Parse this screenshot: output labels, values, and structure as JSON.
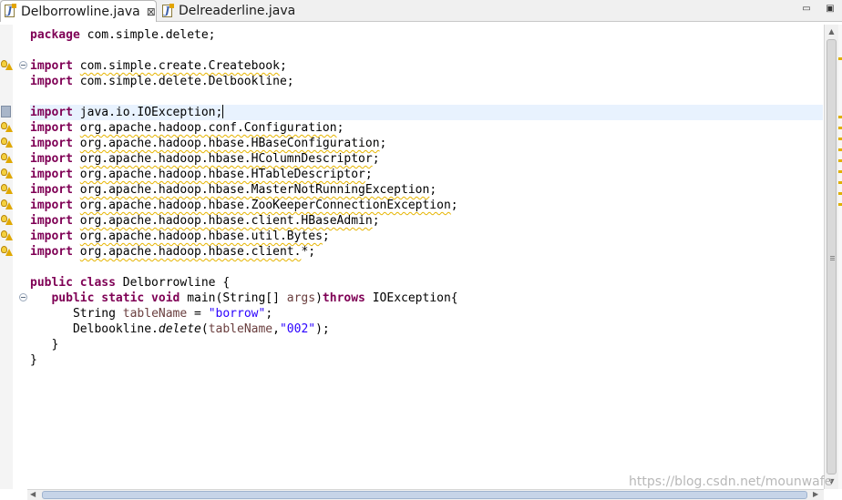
{
  "tabs": [
    {
      "label": "Delborrowline.java",
      "close": "⊠",
      "active": true
    },
    {
      "label": "Delreaderline.java",
      "active": false
    }
  ],
  "window_controls": {
    "minimize": "▭",
    "maximize": "▣"
  },
  "code": {
    "l1": {
      "kw": "package",
      "rest": " com.simple.delete;"
    },
    "l3": {
      "kw": "import",
      "sp": " ",
      "path": "com.simple.create.Createbook",
      "semi": ";"
    },
    "l4": {
      "kw": "import",
      "rest": " com.simple.delete.Delbookline;"
    },
    "l6": {
      "kw": "import",
      "rest": " java.io.IOException;"
    },
    "l7": {
      "kw": "import",
      "sp": " ",
      "path": "org.apache.hadoop.conf.Configuration",
      "semi": ";"
    },
    "l8": {
      "kw": "import",
      "sp": " ",
      "path": "org.apache.hadoop.hbase.HBaseConfiguration",
      "semi": ";"
    },
    "l9": {
      "kw": "import",
      "sp": " ",
      "path": "org.apache.hadoop.hbase.HColumnDescriptor",
      "semi": ";"
    },
    "l10": {
      "kw": "import",
      "sp": " ",
      "path": "org.apache.hadoop.hbase.HTableDescriptor",
      "semi": ";"
    },
    "l11": {
      "kw": "import",
      "sp": " ",
      "path": "org.apache.hadoop.hbase.MasterNotRunningException",
      "semi": ";"
    },
    "l12": {
      "kw": "import",
      "sp": " ",
      "path": "org.apache.hadoop.hbase.ZooKeeperConnectionException",
      "semi": ";"
    },
    "l13": {
      "kw": "import",
      "sp": " ",
      "path": "org.apache.hadoop.hbase.client.HBaseAdmin",
      "semi": ";"
    },
    "l14": {
      "kw": "import",
      "sp": " ",
      "path": "org.apache.hadoop.hbase.util.Bytes",
      "semi": ";"
    },
    "l15": {
      "kw": "import",
      "sp": " ",
      "path": "org.apache.hadoop.hbase.client.",
      "semi": "*;"
    },
    "l17": {
      "kw": "public class",
      "rest": " Delborrowline {"
    },
    "l18": {
      "indent": "   ",
      "kw": "public static void",
      "mid": " main(String[] ",
      "param": "args",
      "close": ")",
      "kw2": "throws",
      "rest": " IOException{"
    },
    "l19": {
      "indent": "      ",
      "type": "String ",
      "var": "tableName",
      "eq": " = ",
      "str": "\"borrow\"",
      "semi": ";"
    },
    "l20": {
      "indent": "      ",
      "cls": "Delbookline.",
      "meth": "delete",
      "open": "(",
      "var": "tableName",
      "comma": ",",
      "str": "\"002\"",
      "end": ");"
    },
    "l21": {
      "text": "   }"
    },
    "l22": {
      "text": "}"
    }
  },
  "watermark": "https://blog.csdn.net/mounwafe"
}
